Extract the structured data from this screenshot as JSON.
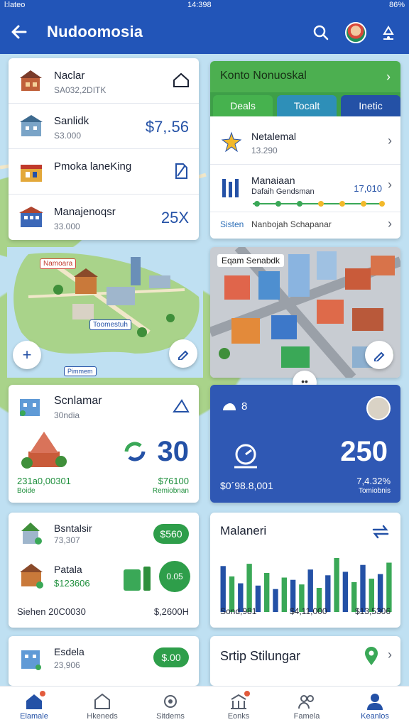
{
  "status_bar": {
    "left": "l:lateo",
    "time": "14:398",
    "battery": "86%"
  },
  "app_bar": {
    "title": "Nudoomosia"
  },
  "list_card": {
    "rows": [
      {
        "name": "Naclar",
        "sub": "SA032,2DITK",
        "value": ""
      },
      {
        "name": "Sanlidk",
        "sub": "S3.000",
        "value": "$7,.56"
      },
      {
        "name": "Pmoka laneKing",
        "sub": "",
        "value": ""
      },
      {
        "name": "Manajenoqsr",
        "sub": "33.000",
        "value": "25X"
      }
    ]
  },
  "top_right_card": {
    "header": "Konto Nonuoskal",
    "tabs": [
      "Deals",
      "Tocalt",
      "Inetic"
    ],
    "row1": {
      "name": "Netalemal",
      "sub": "13.290"
    },
    "row2": {
      "name": "Manaiaan",
      "sub": "Dafaih Gendsman",
      "value": "17,010"
    },
    "footer_a": "Sisten",
    "footer_b": "Nanbojah Schapanar"
  },
  "map": {
    "label_red": "Namoara",
    "label_blue": "Toomestuh",
    "label_small": "Pimmem"
  },
  "city_card": {
    "label": "Eqam Senabdk"
  },
  "stat_left": {
    "name": "Scnlamar",
    "sub": "30ndia",
    "big": "30",
    "g1": "231a0,00301",
    "g2": "Boide",
    "g3": "$76100",
    "g4": "Remiobnan"
  },
  "stat_right": {
    "name": "8",
    "big": "250",
    "l1": "$0´98.8,001",
    "r1": "7,4.32%",
    "r2": "Tomiobnis"
  },
  "card3_left": {
    "n1": "Bsntalsir",
    "s1": "73,307",
    "pill": "$560",
    "n2": "Patala",
    "s2": "$123606",
    "circle": "0.05",
    "f1": "Siehen  20C0030",
    "f2": "$,2600H"
  },
  "card3_right": {
    "title": "Malaneri",
    "f1": "Sond,981",
    "f2": "$4,11,000",
    "f3": "$13,5306",
    "chart_data": {
      "type": "bar",
      "values": [
        80,
        62,
        50,
        84,
        46,
        68,
        40,
        60,
        56,
        48,
        74,
        42,
        64,
        94,
        70,
        52,
        82,
        58,
        66,
        86
      ]
    }
  },
  "card4_left": {
    "name": "Esdela",
    "sub": "23,906",
    "pill": "$.00"
  },
  "card4_right": {
    "title": "Srtip Stilungar"
  },
  "bottom_nav": [
    "Elamale",
    "Hkeneds",
    "Sitdems",
    "Eonks",
    "Famela",
    "Keanlos"
  ]
}
